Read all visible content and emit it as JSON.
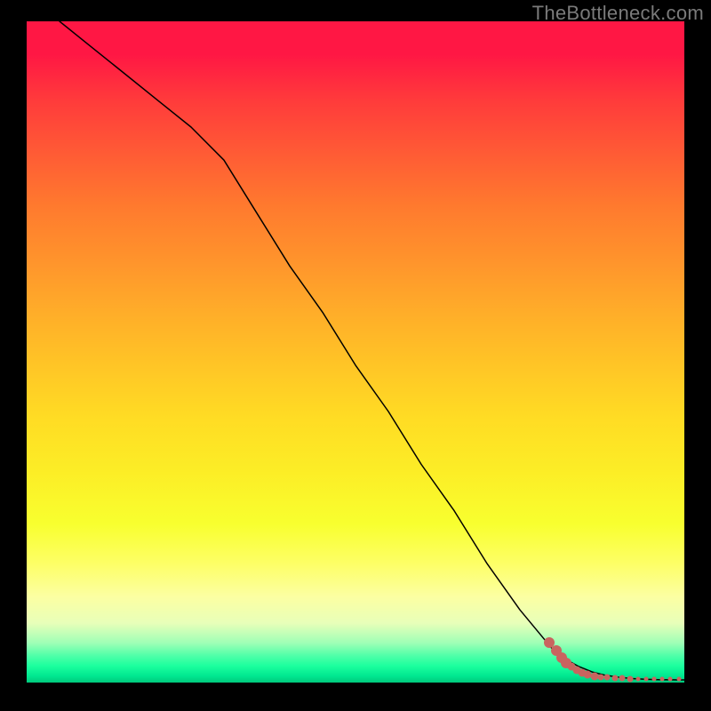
{
  "watermark": "TheBottleneck.com",
  "colors": {
    "frame_bg": "#000000",
    "watermark": "#7a7a7a",
    "curve": "#000000",
    "dot": "#c9645f"
  },
  "chart_data": {
    "type": "line",
    "title": "",
    "xlabel": "",
    "ylabel": "",
    "xlim": [
      0,
      100
    ],
    "ylim": [
      0,
      100
    ],
    "grid": false,
    "series": [
      {
        "name": "curve",
        "x": [
          5,
          10,
          15,
          20,
          25,
          30,
          35,
          40,
          45,
          50,
          55,
          60,
          65,
          70,
          75,
          80,
          82,
          84,
          86,
          88,
          90,
          92,
          94,
          96,
          98,
          100
        ],
        "y": [
          100,
          96,
          92,
          88,
          84,
          79,
          71,
          63,
          56,
          48,
          41,
          33,
          26,
          18,
          11,
          5,
          3.5,
          2.4,
          1.6,
          1.1,
          0.8,
          0.6,
          0.5,
          0.45,
          0.42,
          0.4
        ]
      }
    ],
    "marker_cluster": {
      "comment": "Dense red-ish markers along the tail of the curve (approximate from pixels)",
      "points": [
        {
          "x": 79.5,
          "y": 6.0,
          "size": "big"
        },
        {
          "x": 80.5,
          "y": 4.8,
          "size": "big"
        },
        {
          "x": 81.3,
          "y": 3.8,
          "size": "big"
        },
        {
          "x": 82.0,
          "y": 3.0,
          "size": "big"
        },
        {
          "x": 82.8,
          "y": 2.4,
          "size": "mid"
        },
        {
          "x": 83.6,
          "y": 1.9,
          "size": "mid"
        },
        {
          "x": 84.4,
          "y": 1.5,
          "size": "mid"
        },
        {
          "x": 85.3,
          "y": 1.2,
          "size": "mid"
        },
        {
          "x": 86.3,
          "y": 1.0,
          "size": "mid"
        },
        {
          "x": 87.3,
          "y": 0.85,
          "size": "small"
        },
        {
          "x": 88.3,
          "y": 0.75,
          "size": "small"
        },
        {
          "x": 89.4,
          "y": 0.68,
          "size": "small"
        },
        {
          "x": 90.6,
          "y": 0.62,
          "size": "small"
        },
        {
          "x": 91.8,
          "y": 0.58,
          "size": "small"
        },
        {
          "x": 93.0,
          "y": 0.55,
          "size": "tiny"
        },
        {
          "x": 94.2,
          "y": 0.53,
          "size": "tiny"
        },
        {
          "x": 95.4,
          "y": 0.51,
          "size": "tiny"
        },
        {
          "x": 96.6,
          "y": 0.5,
          "size": "tiny"
        },
        {
          "x": 97.8,
          "y": 0.49,
          "size": "tiny"
        },
        {
          "x": 99.2,
          "y": 0.48,
          "size": "tiny"
        }
      ]
    }
  }
}
